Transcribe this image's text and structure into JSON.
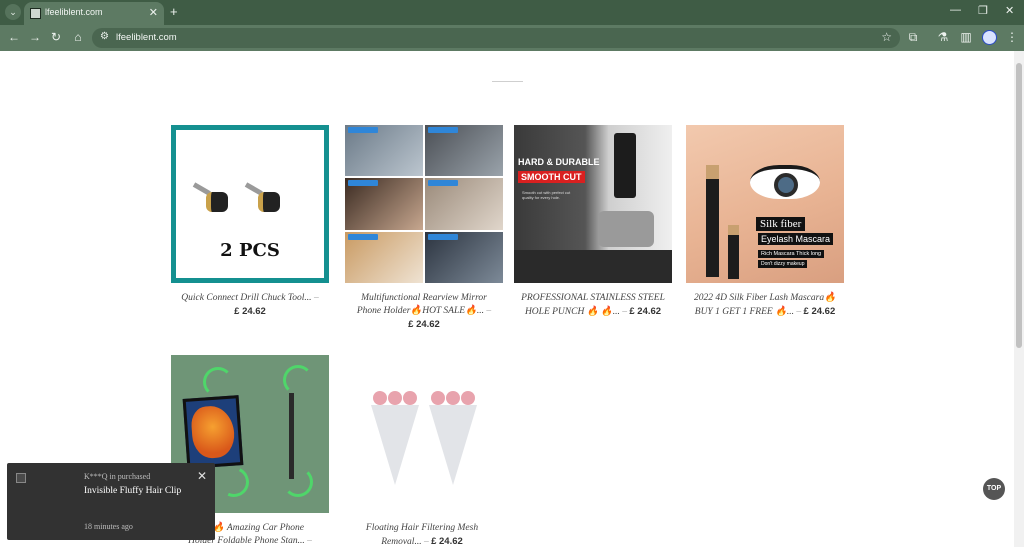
{
  "browser": {
    "tab_title": "lfeeliblent.com",
    "url": "lfeeliblent.com",
    "icons": {
      "tab_menu": "chevron-down-icon",
      "close": "close-icon",
      "new_tab": "plus-icon",
      "back": "back-arrow-icon",
      "forward": "forward-arrow-icon",
      "reload": "reload-icon",
      "home": "home-icon",
      "site_info": "site-info-icon",
      "bookmark": "star-icon",
      "extensions": "puzzle-icon",
      "labs": "flask-icon",
      "sidepanel": "sidepanel-icon",
      "menu": "kebab-menu-icon"
    },
    "colors": {
      "frame": "#3f5c45",
      "toolbar": "#5d7a63"
    }
  },
  "products": [
    {
      "title": "Quick Connect Drill Chuck Tool...",
      "price": "£ 24.62",
      "image_text": "2 PCS"
    },
    {
      "title_line1": "Multifunctional Rearview Mirror",
      "title_line2": "Phone Holder🔥HOT SALE🔥...",
      "price": "£ 24.62"
    },
    {
      "title_line1": "PROFESSIONAL STAINLESS STEEL",
      "title_line2": "HOLE PUNCH 🔥 🔥...",
      "price": "£ 24.62",
      "image_text": [
        "HARD & DURABLE",
        "SMOOTH CUT",
        "Smooth cut with perfect cut quality for every hole."
      ]
    },
    {
      "title_line1": "2022 4D Silk Fiber Lash Mascara🔥",
      "title_line2": "BUY 1 GET 1 FREE 🔥...",
      "price": "£ 24.62",
      "image_text": [
        "Silk fiber",
        "Eyelash Mascara",
        "Rich Mascara Thick long",
        "Don't dizzy makeup"
      ]
    },
    {
      "title_line1": "ALE🔥 Amazing Car Phone",
      "title_line2": "Holder Foldable Phone Stan...",
      "price": ""
    },
    {
      "title_line1": "Floating Hair Filtering Mesh",
      "title_line2": "Removal...",
      "price": "£ 24.62"
    }
  ],
  "dash": "–",
  "popup": {
    "who": "K***Q in purchased",
    "item": "Invisible Fluffy Hair Clip",
    "time": "18 minutes ago"
  },
  "top_button": "TOP"
}
